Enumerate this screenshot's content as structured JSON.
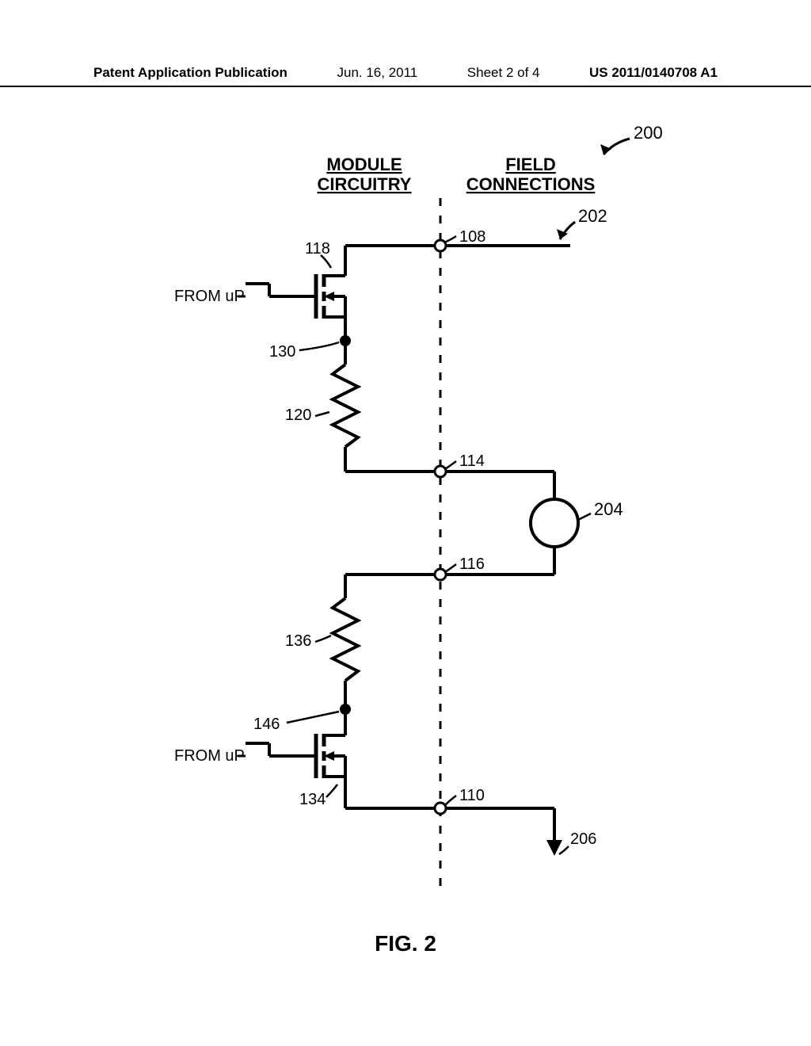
{
  "header": {
    "left": "Patent Application Publication",
    "date": "Jun. 16, 2011",
    "sheet": "Sheet 2 of 4",
    "pubno": "US 2011/0140708 A1"
  },
  "labels": {
    "module_circuitry_l1": "MODULE",
    "module_circuitry_l2": "CIRCUITRY",
    "field_connections_l1": "FIELD",
    "field_connections_l2": "CONNECTIONS",
    "from_up_1": "FROM uP",
    "from_up_2": "FROM uP",
    "ref_200": "200",
    "ref_202": "202",
    "ref_108": "108",
    "ref_118": "118",
    "ref_130": "130",
    "ref_120": "120",
    "ref_114": "114",
    "ref_204": "204",
    "ref_116": "116",
    "ref_136": "136",
    "ref_146": "146",
    "ref_134": "134",
    "ref_110": "110",
    "ref_206": "206"
  },
  "caption": "FIG. 2"
}
